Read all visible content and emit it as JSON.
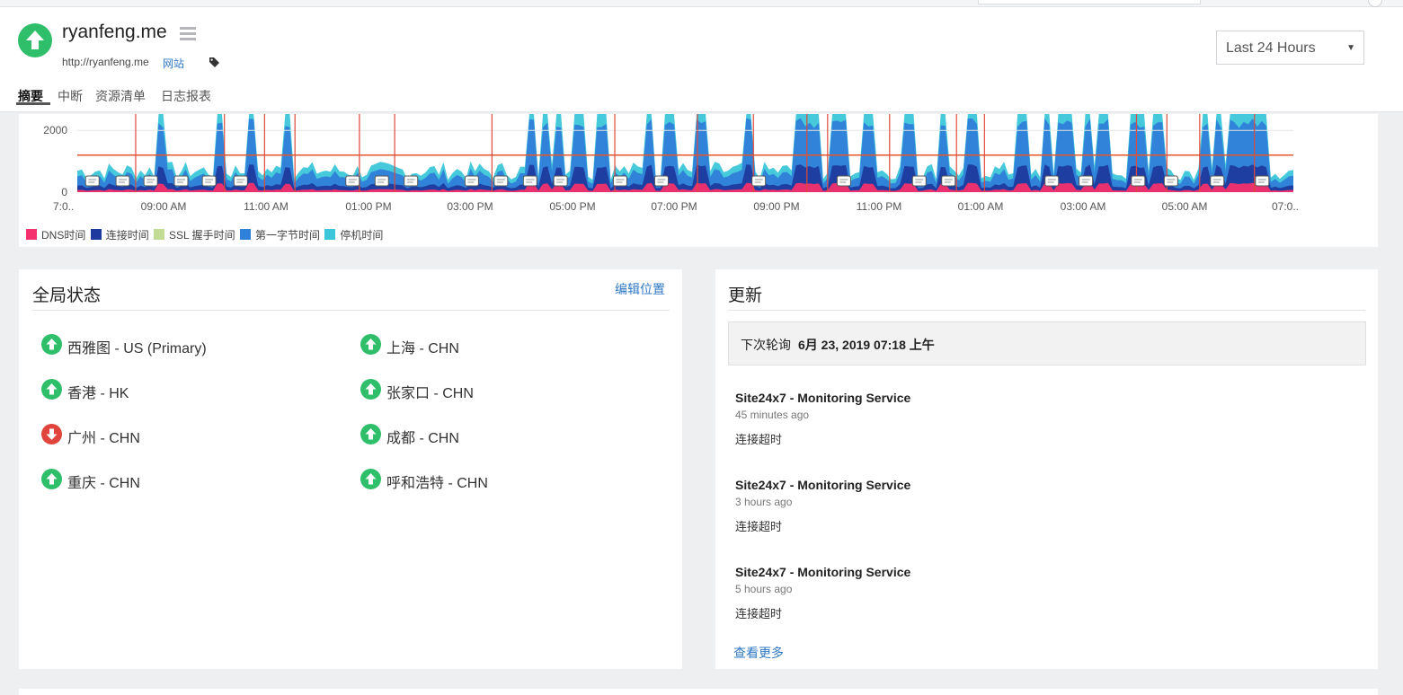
{
  "header": {
    "site_name": "ryanfeng.me",
    "site_url": "http://ryanfeng.me",
    "site_type": "网站",
    "tabs": [
      {
        "label": "摘要",
        "active": true
      },
      {
        "label": "中断"
      },
      {
        "label": "资源清单"
      },
      {
        "label": "日志报表"
      }
    ],
    "time_range": "Last 24 Hours",
    "status_color": "#2fbf6a"
  },
  "chart_data": {
    "type": "area",
    "ytick_labels": [
      "0",
      "2000"
    ],
    "xtick_labels": [
      "7:0..",
      "09:00 AM",
      "11:00 AM",
      "01:00 PM",
      "03:00 PM",
      "05:00 PM",
      "07:00 PM",
      "09:00 PM",
      "11:00 PM",
      "01:00 AM",
      "03:00 AM",
      "05:00 AM",
      "07:0.."
    ],
    "threshold": 1200,
    "legend": [
      {
        "name": "DNS时间",
        "color": "#f4306d"
      },
      {
        "name": "连接时间",
        "color": "#1d3a9e"
      },
      {
        "name": "SSL 握手时间",
        "color": "#c3dc95"
      },
      {
        "name": "第一字节时间",
        "color": "#2f80d9"
      },
      {
        "name": "停机时间",
        "color": "#3bc6d9"
      }
    ]
  },
  "global_status": {
    "title": "全局状态",
    "edit_link": "编辑位置",
    "locations": [
      {
        "name": "西雅图 - US (Primary)",
        "status": "up"
      },
      {
        "name": "上海 - CHN",
        "status": "up"
      },
      {
        "name": "香港 - HK",
        "status": "up"
      },
      {
        "name": "张家口 - CHN",
        "status": "up"
      },
      {
        "name": "广州 - CHN",
        "status": "down"
      },
      {
        "name": "成都 - CHN",
        "status": "up"
      },
      {
        "name": "重庆 - CHN",
        "status": "up"
      },
      {
        "name": "呼和浩特 - CHN",
        "status": "up"
      }
    ]
  },
  "updates": {
    "title": "更新",
    "next_poll_label": "下次轮询",
    "next_poll_time": "6月 23, 2019 07:18 上午",
    "items": [
      {
        "title": "Site24x7 - Monitoring Service",
        "time": "45 minutes ago",
        "message": "连接超时"
      },
      {
        "title": "Site24x7 - Monitoring Service",
        "time": "3 hours ago",
        "message": "连接超时"
      },
      {
        "title": "Site24x7 - Monitoring Service",
        "time": "5 hours ago",
        "message": "连接超时"
      }
    ],
    "more_link": "查看更多"
  }
}
